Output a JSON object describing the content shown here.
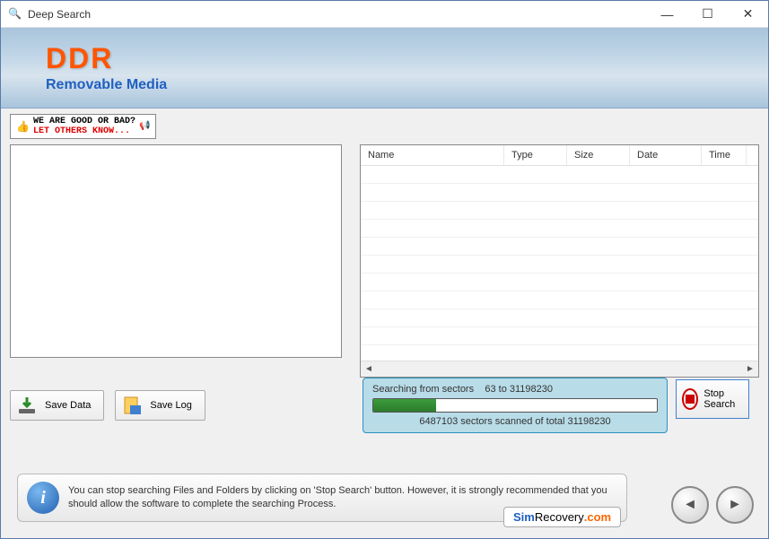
{
  "titlebar": {
    "title": "Deep Search"
  },
  "banner": {
    "logo": "DDR",
    "subtitle": "Removable Media"
  },
  "feedback": {
    "line1": "WE ARE GOOD OR BAD?",
    "line2": "LET OTHERS KNOW..."
  },
  "table": {
    "headers": {
      "name": "Name",
      "type": "Type",
      "size": "Size",
      "date": "Date",
      "time": "Time"
    }
  },
  "buttons": {
    "save_data": "Save Data",
    "save_log": "Save Log",
    "stop_search": "Stop Search"
  },
  "progress": {
    "line1_prefix": "Searching from sectors",
    "range": "63 to 31198230",
    "scanned_count": "6487103",
    "line2_mid": "sectors scanned of total",
    "total": "31198230",
    "percent": 21
  },
  "info": {
    "text": "You can stop searching Files and Folders by clicking on 'Stop Search' button. However, it is strongly recommended that you should allow the software to complete the searching Process."
  },
  "link": {
    "p1": "Sim",
    "p2": "Recovery",
    "p3": ".com"
  }
}
